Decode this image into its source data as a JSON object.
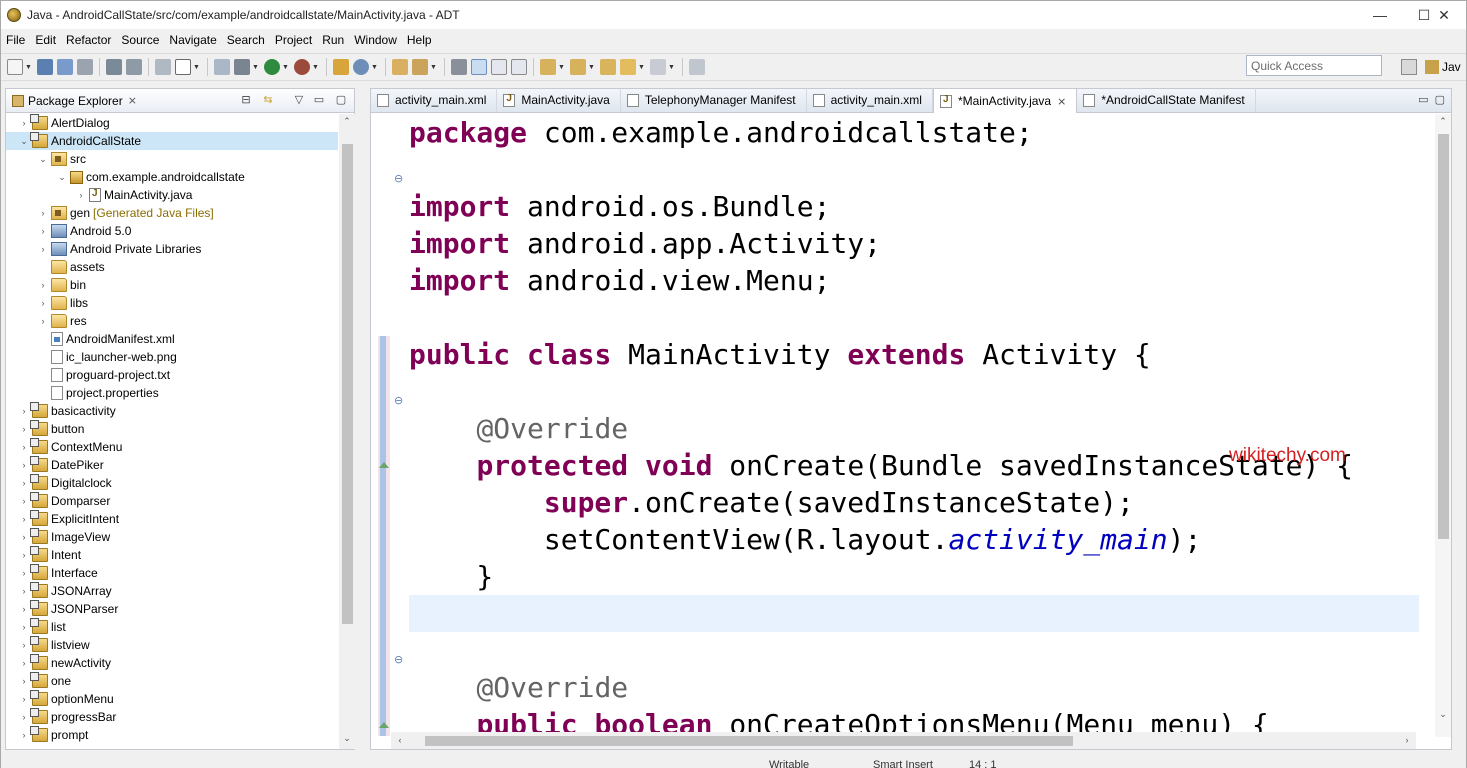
{
  "window": {
    "title": "Java - AndroidCallState/src/com/example/androidcallstate/MainActivity.java - ADT"
  },
  "window_controls": {
    "minimize": "—",
    "maximize": "☐",
    "close": "✕"
  },
  "menu": [
    "File",
    "Edit",
    "Refactor",
    "Source",
    "Navigate",
    "Search",
    "Project",
    "Run",
    "Window",
    "Help"
  ],
  "toolbar": {
    "quick_access_placeholder": "Quick Access",
    "perspective_label": "Jav"
  },
  "package_explorer": {
    "title": "Package Explorer",
    "items": [
      {
        "label": "AlertDialog",
        "depth": 0,
        "icon": "project-icon",
        "twisty": "›"
      },
      {
        "label": "AndroidCallState",
        "depth": 0,
        "icon": "project-icon",
        "twisty": "⌄",
        "selected": true
      },
      {
        "label": "src",
        "depth": 1,
        "icon": "source-folder-icon",
        "twisty": "⌄"
      },
      {
        "label": "com.example.androidcallstate",
        "depth": 2,
        "icon": "package-icon",
        "twisty": "⌄"
      },
      {
        "label": "MainActivity.java",
        "depth": 3,
        "icon": "java-file-icon",
        "twisty": "›"
      },
      {
        "label": "gen",
        "suffix": "[Generated Java Files]",
        "depth": 1,
        "icon": "source-folder-icon",
        "twisty": "›"
      },
      {
        "label": "Android 5.0",
        "depth": 1,
        "icon": "library-icon",
        "twisty": "›"
      },
      {
        "label": "Android Private Libraries",
        "depth": 1,
        "icon": "library-icon",
        "twisty": "›"
      },
      {
        "label": "assets",
        "depth": 1,
        "icon": "folder-icon",
        "twisty": ""
      },
      {
        "label": "bin",
        "depth": 1,
        "icon": "folder-icon",
        "twisty": "›"
      },
      {
        "label": "libs",
        "depth": 1,
        "icon": "folder-icon",
        "twisty": "›"
      },
      {
        "label": "res",
        "depth": 1,
        "icon": "folder-icon",
        "twisty": "›"
      },
      {
        "label": "AndroidManifest.xml",
        "depth": 1,
        "icon": "xml-file-icon",
        "twisty": ""
      },
      {
        "label": "ic_launcher-web.png",
        "depth": 1,
        "icon": "file-icon",
        "twisty": ""
      },
      {
        "label": "proguard-project.txt",
        "depth": 1,
        "icon": "file-icon",
        "twisty": ""
      },
      {
        "label": "project.properties",
        "depth": 1,
        "icon": "file-icon",
        "twisty": ""
      },
      {
        "label": "basicactivity",
        "depth": 0,
        "icon": "project-icon",
        "twisty": "›"
      },
      {
        "label": "button",
        "depth": 0,
        "icon": "project-icon",
        "twisty": "›"
      },
      {
        "label": "ContextMenu",
        "depth": 0,
        "icon": "project-icon",
        "twisty": "›"
      },
      {
        "label": "DatePiker",
        "depth": 0,
        "icon": "project-icon",
        "twisty": "›"
      },
      {
        "label": "Digitalclock",
        "depth": 0,
        "icon": "project-icon",
        "twisty": "›"
      },
      {
        "label": "Domparser",
        "depth": 0,
        "icon": "project-icon",
        "twisty": "›"
      },
      {
        "label": "ExplicitIntent",
        "depth": 0,
        "icon": "project-icon",
        "twisty": "›"
      },
      {
        "label": "ImageView",
        "depth": 0,
        "icon": "project-icon",
        "twisty": "›"
      },
      {
        "label": "Intent",
        "depth": 0,
        "icon": "project-icon",
        "twisty": "›"
      },
      {
        "label": "Interface",
        "depth": 0,
        "icon": "project-icon",
        "twisty": "›"
      },
      {
        "label": "JSONArray",
        "depth": 0,
        "icon": "project-icon",
        "twisty": "›"
      },
      {
        "label": "JSONParser",
        "depth": 0,
        "icon": "project-icon",
        "twisty": "›"
      },
      {
        "label": "list",
        "depth": 0,
        "icon": "project-icon",
        "twisty": "›"
      },
      {
        "label": "listview",
        "depth": 0,
        "icon": "project-icon",
        "twisty": "›"
      },
      {
        "label": "newActivity",
        "depth": 0,
        "icon": "project-icon",
        "twisty": "›"
      },
      {
        "label": "one",
        "depth": 0,
        "icon": "project-icon",
        "twisty": "›"
      },
      {
        "label": "optionMenu",
        "depth": 0,
        "icon": "project-icon",
        "twisty": "›"
      },
      {
        "label": "progressBar",
        "depth": 0,
        "icon": "project-icon",
        "twisty": "›"
      },
      {
        "label": "prompt",
        "depth": 0,
        "icon": "project-icon",
        "twisty": "›"
      }
    ]
  },
  "editor": {
    "tabs": [
      {
        "label": "activity_main.xml",
        "icon": "xml-file-icon"
      },
      {
        "label": "MainActivity.java",
        "icon": "java-file-icon"
      },
      {
        "label": "TelephonyManager Manifest",
        "icon": "xml-file-icon"
      },
      {
        "label": "activity_main.xml",
        "icon": "xml-file-icon"
      },
      {
        "label": "*MainActivity.java",
        "icon": "java-file-icon",
        "active": true,
        "close": "⨯"
      },
      {
        "label": "*AndroidCallState Manifest",
        "icon": "xml-file-icon"
      }
    ],
    "code_lines": [
      [
        {
          "t": "package",
          "k": "kw"
        },
        {
          "t": " com.example.androidcallstate;"
        }
      ],
      [],
      [
        {
          "t": "import",
          "k": "kw"
        },
        {
          "t": " android.os.Bundle;"
        }
      ],
      [
        {
          "t": "import",
          "k": "kw"
        },
        {
          "t": " android.app.Activity;"
        }
      ],
      [
        {
          "t": "import",
          "k": "kw"
        },
        {
          "t": " android.view.Menu;"
        }
      ],
      [],
      [
        {
          "t": "public",
          "k": "kw"
        },
        {
          "t": " "
        },
        {
          "t": "class",
          "k": "kw"
        },
        {
          "t": " MainActivity "
        },
        {
          "t": "extends",
          "k": "kw"
        },
        {
          "t": " Activity {"
        }
      ],
      [],
      [
        {
          "t": "    "
        },
        {
          "t": "@Override",
          "k": "ann"
        }
      ],
      [
        {
          "t": "    "
        },
        {
          "t": "protected",
          "k": "kw"
        },
        {
          "t": " "
        },
        {
          "t": "void",
          "k": "kw"
        },
        {
          "t": " onCreate(Bundle savedInstanceState) {"
        }
      ],
      [
        {
          "t": "        "
        },
        {
          "t": "super",
          "k": "kw"
        },
        {
          "t": ".onCreate(savedInstanceState);"
        }
      ],
      [
        {
          "t": "        setContentView(R.layout."
        },
        {
          "t": "activity_main",
          "k": "it"
        },
        {
          "t": ");"
        }
      ],
      [
        {
          "t": "    }"
        }
      ],
      [],
      [],
      [
        {
          "t": "    "
        },
        {
          "t": "@Override",
          "k": "ann"
        }
      ],
      [
        {
          "t": "    "
        },
        {
          "t": "public",
          "k": "kw"
        },
        {
          "t": " "
        },
        {
          "t": "boolean",
          "k": "kw"
        },
        {
          "t": " onCreateOptionsMenu(Menu menu) {"
        }
      ]
    ],
    "current_line_index": 13,
    "watermark": "wikitechy.com"
  },
  "status": {
    "writable": "Writable",
    "insert_mode": "Smart Insert",
    "position": "14 : 1"
  },
  "colors": {
    "keyword": "#7f0055",
    "annotation": "#646464",
    "field": "#0000c0",
    "current_line": "#e8f2fe",
    "selection": "#cde6f7"
  }
}
